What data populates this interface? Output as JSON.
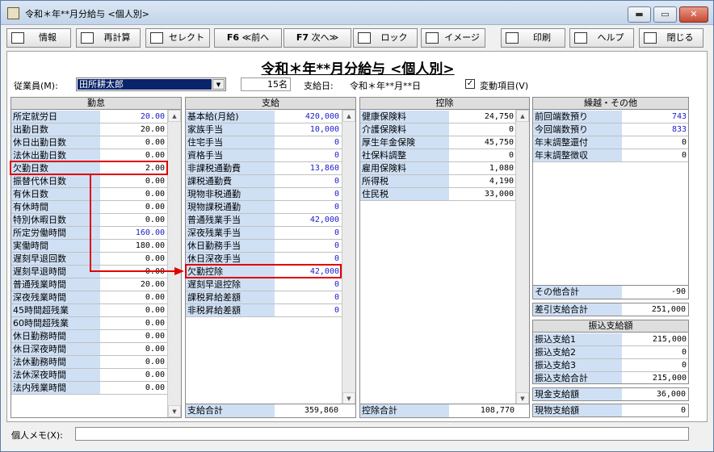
{
  "window": {
    "title": "令和＊年**月分給与 <個人別>"
  },
  "window_controls": {
    "minimize": "▬",
    "maximize": "▭",
    "close": "✕"
  },
  "toolbar": {
    "info": "情報",
    "recalc": "再計算",
    "select": "セレクト",
    "prev_key": "F6",
    "prev": "≪前へ",
    "next_key": "F7",
    "next": "次へ≫",
    "lock": "ロック",
    "image": "イメージ",
    "print": "印刷",
    "help": "ヘルプ",
    "close": "閉じる"
  },
  "heading": "令和＊年**月分給与 <個人別>",
  "employee": {
    "label": "従業員(M):",
    "selected": "田所耕太郎",
    "arrow": "▼",
    "count": "15名",
    "pay_date_label": "支給日:",
    "pay_date": "令和＊年**月**日",
    "variable_check": "✓",
    "variable_label": "変動項目(V)"
  },
  "attendance": {
    "header": "勤怠",
    "rows": [
      {
        "label": "所定就労日",
        "value": "20.00",
        "blue": true
      },
      {
        "label": "出勤日数",
        "value": "20.00",
        "blue": false
      },
      {
        "label": "休日出勤日数",
        "value": "0.00",
        "blue": false
      },
      {
        "label": "法休出勤日数",
        "value": "0.00",
        "blue": false
      },
      {
        "label": "欠勤日数",
        "value": "2.00",
        "blue": false
      },
      {
        "label": "振替代休日数",
        "value": "0.00",
        "blue": false
      },
      {
        "label": "有休日数",
        "value": "0.00",
        "blue": false
      },
      {
        "label": "有休時間",
        "value": "0.00",
        "blue": false
      },
      {
        "label": "特別休暇日数",
        "value": "0.00",
        "blue": false
      },
      {
        "label": "所定労働時間",
        "value": "160.00",
        "blue": true
      },
      {
        "label": "実働時間",
        "value": "180.00",
        "blue": false
      },
      {
        "label": "遅刻早退回数",
        "value": "0.00",
        "blue": false
      },
      {
        "label": "遅刻早退時間",
        "value": "0.00",
        "blue": false
      },
      {
        "label": "普通残業時間",
        "value": "20.00",
        "blue": false
      },
      {
        "label": "深夜残業時間",
        "value": "0.00",
        "blue": false
      },
      {
        "label": "45時間超残業",
        "value": "0.00",
        "blue": false
      },
      {
        "label": "60時間超残業",
        "value": "0.00",
        "blue": false
      },
      {
        "label": "休日勤務時間",
        "value": "0.00",
        "blue": false
      },
      {
        "label": "休日深夜時間",
        "value": "0.00",
        "blue": false
      },
      {
        "label": "法休勤務時間",
        "value": "0.00",
        "blue": false
      },
      {
        "label": "法休深夜時間",
        "value": "0.00",
        "blue": false
      },
      {
        "label": "法内残業時間",
        "value": "0.00",
        "blue": false
      }
    ]
  },
  "payments": {
    "header": "支給",
    "rows": [
      {
        "label": "基本給(月給)",
        "value": "420,000"
      },
      {
        "label": "家族手当",
        "value": "10,000"
      },
      {
        "label": "住宅手当",
        "value": "0"
      },
      {
        "label": "資格手当",
        "value": "0"
      },
      {
        "label": "非課税通勤費",
        "value": "13,860"
      },
      {
        "label": "課税通勤費",
        "value": "0"
      },
      {
        "label": "現物非税通勤",
        "value": "0"
      },
      {
        "label": "現物課税通勤",
        "value": "0"
      },
      {
        "label": "普通残業手当",
        "value": "42,000"
      },
      {
        "label": "深夜残業手当",
        "value": "0"
      },
      {
        "label": "休日勤務手当",
        "value": "0"
      },
      {
        "label": "休日深夜手当",
        "value": "0"
      },
      {
        "label": "欠勤控除",
        "value": "42,000"
      },
      {
        "label": "遅刻早退控除",
        "value": "0"
      },
      {
        "label": "課税昇給差額",
        "value": "0"
      },
      {
        "label": "非税昇給差額",
        "value": "0"
      }
    ],
    "total_label": "支給合計",
    "total": "359,860"
  },
  "deductions": {
    "header": "控除",
    "rows": [
      {
        "label": "健康保険料",
        "value": "24,750"
      },
      {
        "label": "介護保険料",
        "value": "0"
      },
      {
        "label": "厚生年金保険",
        "value": "45,750"
      },
      {
        "label": "社保料調整",
        "value": "0"
      },
      {
        "label": "雇用保険料",
        "value": "1,080"
      },
      {
        "label": "所得税",
        "value": "4,190"
      },
      {
        "label": "住民税",
        "value": "33,000"
      }
    ],
    "total_label": "控除合計",
    "total": "108,770"
  },
  "carryover": {
    "header": "繰越・その他",
    "rows": [
      {
        "label": "前回端数預り",
        "value": "743",
        "blue": true
      },
      {
        "label": "今回端数預り",
        "value": "833",
        "blue": true
      },
      {
        "label": "年末調整還付",
        "value": "0",
        "blue": false
      },
      {
        "label": "年末調整徴収",
        "value": "0",
        "blue": false
      }
    ],
    "other_total_label": "その他合計",
    "other_total": "-90"
  },
  "net": {
    "label": "差引支給合計",
    "value": "251,000"
  },
  "transfer": {
    "header": "振込支給額",
    "rows": [
      {
        "label": "振込支給1",
        "value": "215,000"
      },
      {
        "label": "振込支給2",
        "value": "0"
      },
      {
        "label": "振込支給3",
        "value": "0"
      },
      {
        "label": "振込支給合計",
        "value": "215,000"
      }
    ]
  },
  "cash": {
    "label": "現金支給額",
    "value": "36,000"
  },
  "in_kind": {
    "label": "現物支給額",
    "value": "0"
  },
  "memo": {
    "label": "個人メモ(X):",
    "value": ""
  },
  "scroll": {
    "up": "▲",
    "down": "▼"
  },
  "colors": {
    "highlight": "#e00000",
    "accent_blue": "#1a1acc",
    "label_bg": "#cfe0f5"
  }
}
